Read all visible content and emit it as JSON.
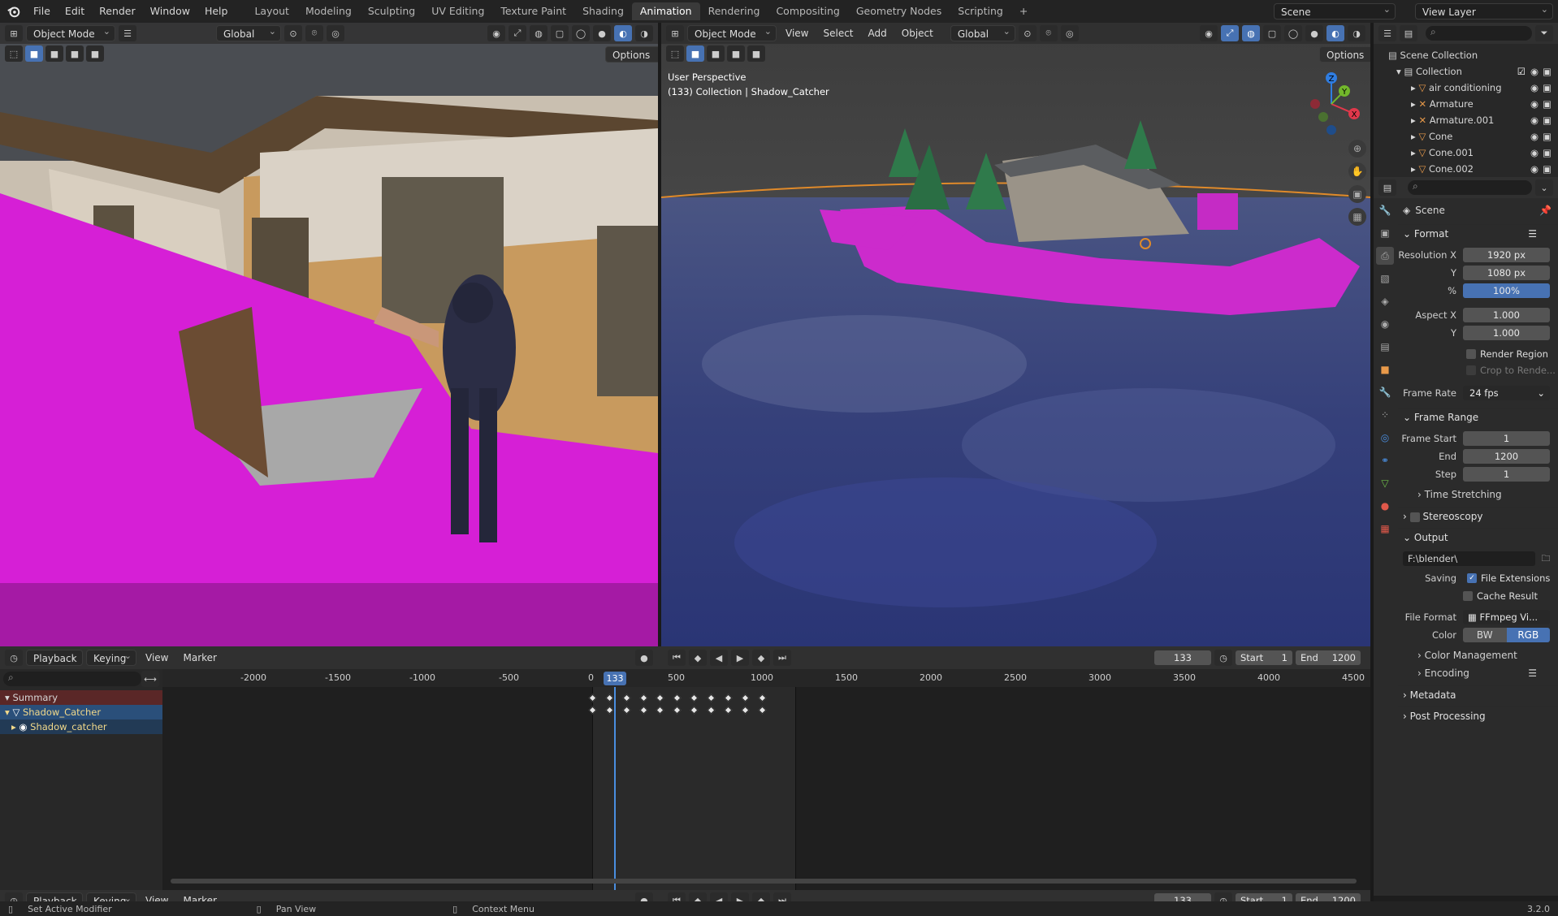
{
  "topbar": {
    "menus": [
      "File",
      "Edit",
      "Render",
      "Window",
      "Help"
    ],
    "workspaces": [
      "Layout",
      "Modeling",
      "Sculpting",
      "UV Editing",
      "Texture Paint",
      "Shading",
      "Animation",
      "Rendering",
      "Compositing",
      "Geometry Nodes",
      "Scripting"
    ],
    "active_workspace": "Animation",
    "scene_label": "Scene",
    "view_layer_label": "View Layer"
  },
  "left_viewport": {
    "mode": "Object Mode",
    "orientation": "Global",
    "options_label": "Options"
  },
  "right_viewport": {
    "mode": "Object Mode",
    "menus": [
      "View",
      "Select",
      "Add",
      "Object"
    ],
    "orientation": "Global",
    "options_label": "Options",
    "overlay_line1": "User Perspective",
    "overlay_line2": "(133) Collection | Shadow_Catcher",
    "gizmo_z": "Z",
    "gizmo_y": "Y",
    "gizmo_x": "X"
  },
  "outliner": {
    "root": "Scene Collection",
    "collection": "Collection",
    "items": [
      "air conditioning",
      "Armature",
      "Armature.001",
      "Cone",
      "Cone.001",
      "Cone.002"
    ]
  },
  "properties": {
    "scene_label": "Scene",
    "format": {
      "title": "Format",
      "res_x_label": "Resolution X",
      "res_x": "1920 px",
      "res_y_label": "Y",
      "res_y": "1080 px",
      "pct_label": "%",
      "pct": "100%",
      "aspect_x_label": "Aspect X",
      "aspect_x": "1.000",
      "aspect_y_label": "Y",
      "aspect_y": "1.000",
      "render_region": "Render Region",
      "crop": "Crop to Rende...",
      "frame_rate_label": "Frame Rate",
      "frame_rate": "24 fps"
    },
    "frame_range": {
      "title": "Frame Range",
      "start_label": "Frame Start",
      "start": "1",
      "end_label": "End",
      "end": "1200",
      "step_label": "Step",
      "step": "1",
      "time_stretching": "Time Stretching"
    },
    "stereoscopy": "Stereoscopy",
    "output": {
      "title": "Output",
      "path": "F:\\blender\\",
      "saving_label": "Saving",
      "file_extensions": "File Extensions",
      "cache_result": "Cache Result",
      "file_format_label": "File Format",
      "file_format": "FFmpeg Vi...",
      "color_label": "Color",
      "bw": "BW",
      "rgb": "RGB",
      "color_management": "Color Management",
      "encoding": "Encoding"
    },
    "metadata": "Metadata",
    "post_processing": "Post Processing"
  },
  "timeline": {
    "menus": [
      "Playback",
      "Keying",
      "View",
      "Marker"
    ],
    "current_frame": "133",
    "start_label": "Start",
    "start": "1",
    "end_label": "End",
    "end": "1200",
    "ticks": [
      "-2000",
      "-1500",
      "-1000",
      "-500",
      "0",
      "500",
      "1000",
      "1500",
      "2000",
      "2500",
      "3000",
      "3500",
      "4000",
      "4500"
    ],
    "channels": [
      "Summary",
      "Shadow_Catcher",
      "Shadow_catcher"
    ],
    "keyframes": [
      0,
      100,
      200,
      300,
      400,
      500,
      600,
      700,
      800,
      900,
      1000
    ]
  },
  "statusbar": {
    "items": [
      "Set Active Modifier",
      "Pan View",
      "Context Menu"
    ],
    "version": "3.2.0"
  }
}
